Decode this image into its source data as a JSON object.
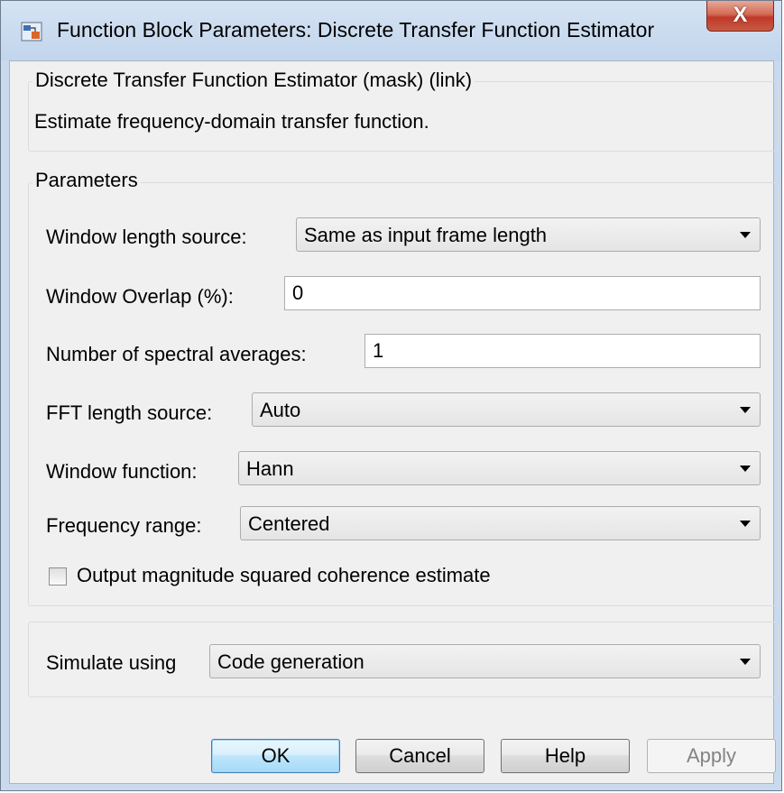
{
  "window": {
    "title": "Function Block Parameters: Discrete Transfer Function Estimator",
    "close_label": "X"
  },
  "description_group": {
    "legend": "Discrete Transfer Function Estimator (mask) (link)",
    "text": "Estimate frequency-domain transfer function."
  },
  "parameters_group": {
    "legend": "Parameters",
    "window_length_source": {
      "label": "Window length source:",
      "value": "Same as input frame length"
    },
    "window_overlap": {
      "label": "Window Overlap (%):",
      "value": "0"
    },
    "spectral_averages": {
      "label": "Number of spectral averages:",
      "value": "1"
    },
    "fft_length_source": {
      "label": "FFT length source:",
      "value": "Auto"
    },
    "window_function": {
      "label": "Window function:",
      "value": "Hann"
    },
    "frequency_range": {
      "label": "Frequency range:",
      "value": "Centered"
    },
    "coherence_checkbox": {
      "label": "Output magnitude squared coherence estimate",
      "checked": false
    }
  },
  "simulate_group": {
    "label": "Simulate using",
    "value": "Code generation"
  },
  "buttons": {
    "ok": "OK",
    "cancel": "Cancel",
    "help": "Help",
    "apply": "Apply"
  },
  "icons": {
    "app_icon": "simulink-block-icon",
    "close_icon": "close-icon",
    "dropdown_icon": "chevron-down-icon"
  }
}
